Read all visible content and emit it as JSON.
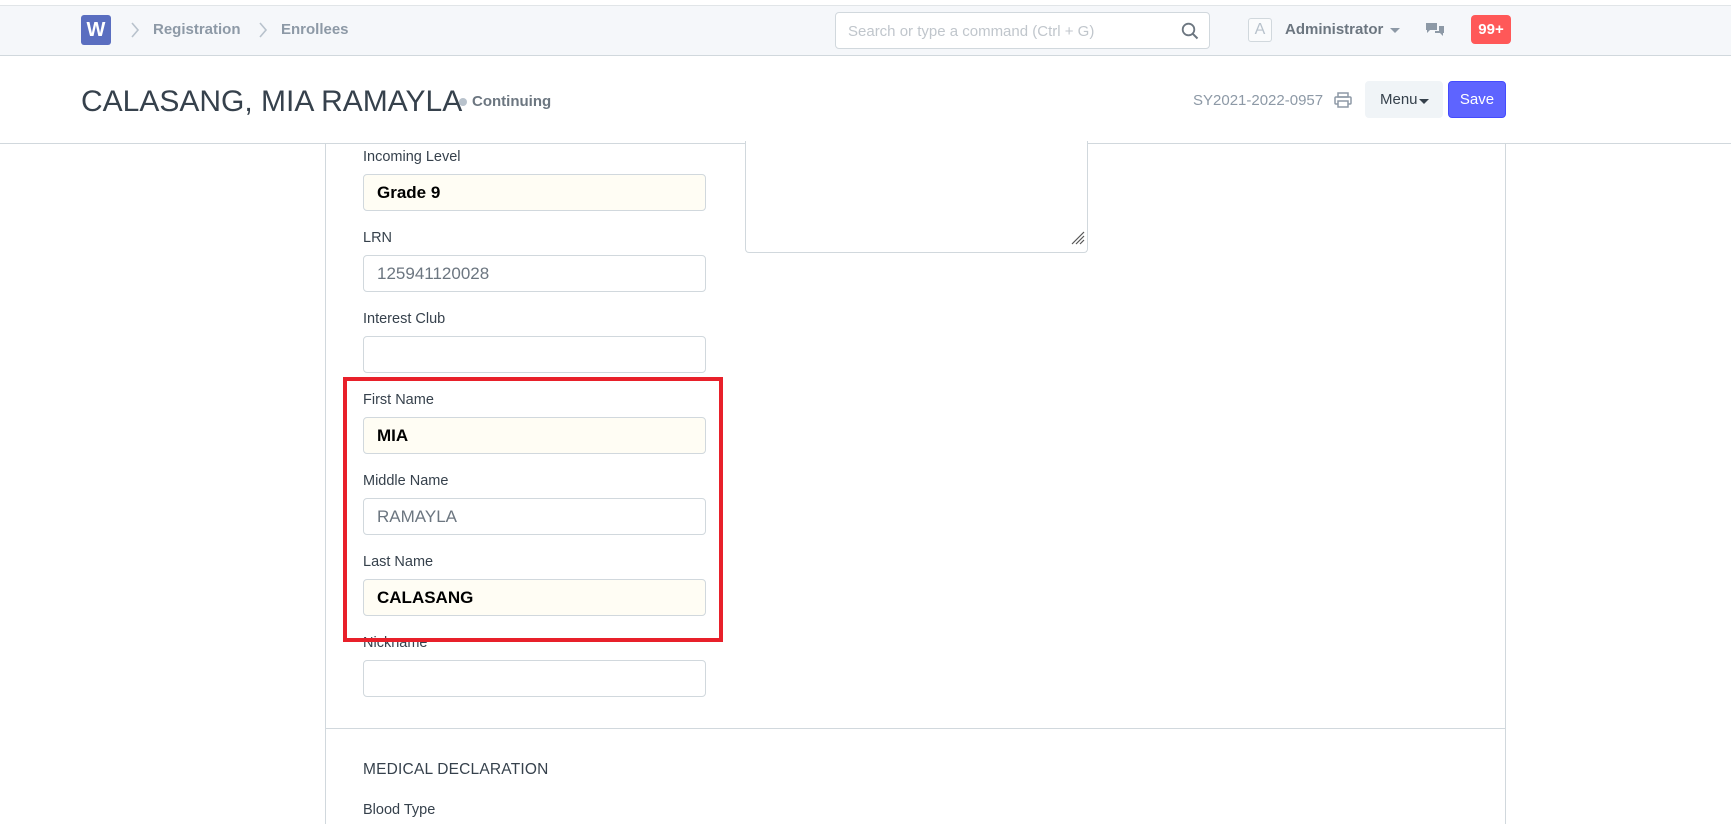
{
  "navbar": {
    "logo_letter": "W",
    "breadcrumbs": [
      "Registration",
      "Enrollees"
    ],
    "search_placeholder": "Search or type a command (Ctrl + G)",
    "avatar_letter": "A",
    "user_name": "Administrator",
    "notification_count": "99+"
  },
  "header": {
    "title": "CALASANG, MIA RAMAYLA",
    "status": "Continuing",
    "doc_name": "SY2021-2022-0957",
    "menu_label": "Menu",
    "save_label": "Save"
  },
  "form": {
    "fields": [
      {
        "label": "Incoming Level",
        "value": "Grade 9"
      },
      {
        "label": "LRN",
        "value": "125941120028"
      },
      {
        "label": "Interest Club",
        "value": ""
      },
      {
        "label": "First Name",
        "value": "MIA"
      },
      {
        "label": "Middle Name",
        "value": "RAMAYLA"
      },
      {
        "label": "Last Name",
        "value": "CALASANG"
      },
      {
        "label": "Nickname",
        "value": ""
      }
    ],
    "section_title": "MEDICAL DECLARATION",
    "next_field_label": "Blood Type"
  },
  "colors": {
    "primary": "#5e64ff",
    "notification": "#ff5858",
    "highlight": "#e8202a",
    "mandatory_bg": "#fffdf4"
  }
}
